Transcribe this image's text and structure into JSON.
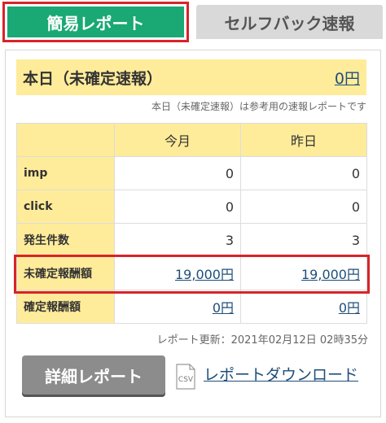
{
  "tabs": {
    "simple_report": "簡易レポート",
    "selfback_report": "セルフバック速報"
  },
  "today": {
    "label": "本日（未確定速報）",
    "value": "0円",
    "note": "本日（未確定速報）は参考用の速報レポートです"
  },
  "table": {
    "columns": [
      "今月",
      "昨日"
    ],
    "rows": [
      {
        "label": "imp",
        "this_month": "0",
        "yesterday": "0"
      },
      {
        "label": "click",
        "this_month": "0",
        "yesterday": "0"
      },
      {
        "label": "発生件数",
        "this_month": "3",
        "yesterday": "3"
      },
      {
        "label": "未確定報酬額",
        "this_month": "19,000円",
        "yesterday": "19,000円"
      },
      {
        "label": "確定報酬額",
        "this_month": "0円",
        "yesterday": "0円"
      }
    ]
  },
  "updated": "レポート更新：2021年02月12日 02時35分",
  "actions": {
    "detail_button": "詳細レポート",
    "csv_icon_text": "CSV",
    "download_link": "レポートダウンロード"
  },
  "colors": {
    "tab_active": "#1aa874",
    "highlight_border": "#d8232a",
    "header_bg": "#ffec9a",
    "link": "#1f4e79"
  }
}
